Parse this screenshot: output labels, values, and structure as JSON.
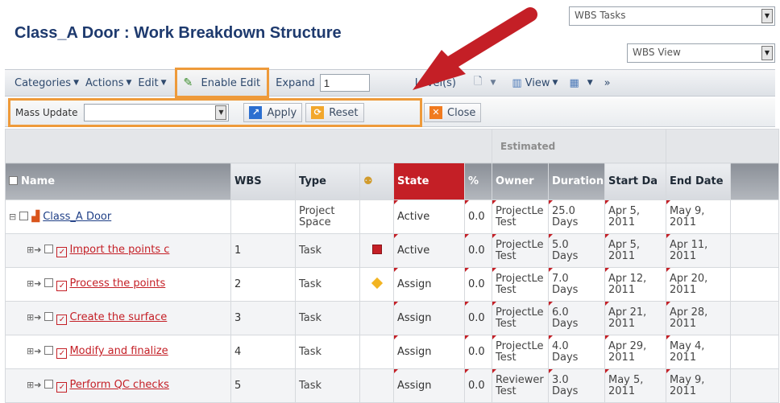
{
  "title": "Class_A Door : Work Breakdown Structure",
  "top_selects": {
    "tasks": "WBS Tasks",
    "view": "WBS View"
  },
  "toolbar": {
    "categories": "Categories",
    "actions": "Actions",
    "edit": "Edit",
    "enable_edit": "Enable Edit",
    "expand": "Expand",
    "expand_value": "1",
    "level": "Level(s)",
    "view": "View",
    "more": "»"
  },
  "mass_update": {
    "label": "Mass Update",
    "apply": "Apply",
    "reset": "Reset",
    "close": "Close"
  },
  "table": {
    "group_header": "Estimated",
    "columns": {
      "name": "Name",
      "wbs": "WBS",
      "type": "Type",
      "state": "State",
      "percent": "%",
      "owner": "Owner",
      "duration": "Duration",
      "start": "Start Da",
      "end": "End Date"
    },
    "rows": [
      {
        "name": "Class_A Door",
        "wbs": "",
        "type_line1": "Project",
        "type_line2": "Space",
        "status": "",
        "state": "Active",
        "pct": "0.0",
        "owner1": "ProjectLe",
        "owner2": "Test",
        "dur1": "25.0",
        "dur2": "Days",
        "start1": "Apr 5,",
        "start2": "2011",
        "end1": "May 9,",
        "end2": "2011"
      },
      {
        "name": "Import the points c",
        "wbs": "1",
        "type_line1": "Task",
        "type_line2": "",
        "status": "red",
        "state": "Active",
        "pct": "0.0",
        "owner1": "ProjectLe",
        "owner2": "Test",
        "dur1": "5.0",
        "dur2": "Days",
        "start1": "Apr 5,",
        "start2": "2011",
        "end1": "Apr 11,",
        "end2": "2011"
      },
      {
        "name": "Process the points",
        "wbs": "2",
        "type_line1": "Task",
        "type_line2": "",
        "status": "diamond",
        "state": "Assign",
        "pct": "0.0",
        "owner1": "ProjectLe",
        "owner2": "Test",
        "dur1": "7.0",
        "dur2": "Days",
        "start1": "Apr 12,",
        "start2": "2011",
        "end1": "Apr 20,",
        "end2": "2011"
      },
      {
        "name": "Create the surface",
        "wbs": "3",
        "type_line1": "Task",
        "type_line2": "",
        "status": "",
        "state": "Assign",
        "pct": "0.0",
        "owner1": "ProjectLe",
        "owner2": "Test",
        "dur1": "6.0",
        "dur2": "Days",
        "start1": "Apr 21,",
        "start2": "2011",
        "end1": "Apr 28,",
        "end2": "2011"
      },
      {
        "name": "Modify and finalize",
        "wbs": "4",
        "type_line1": "Task",
        "type_line2": "",
        "status": "",
        "state": "Assign",
        "pct": "0.0",
        "owner1": "ProjectLe",
        "owner2": "Test",
        "dur1": "4.0",
        "dur2": "Days",
        "start1": "Apr 29,",
        "start2": "2011",
        "end1": "May 4,",
        "end2": "2011"
      },
      {
        "name": "Perform QC checks",
        "wbs": "5",
        "type_line1": "Task",
        "type_line2": "",
        "status": "",
        "state": "Assign",
        "pct": "0.0",
        "owner1": "Reviewer",
        "owner2": "Test",
        "dur1": "3.0",
        "dur2": "Days",
        "start1": "May 5,",
        "start2": "2011",
        "end1": "May 9,",
        "end2": "2011"
      }
    ]
  },
  "colors": {
    "highlight": "#ee9a3a",
    "accent_red": "#c41f26",
    "title_blue": "#1e3a6e"
  }
}
